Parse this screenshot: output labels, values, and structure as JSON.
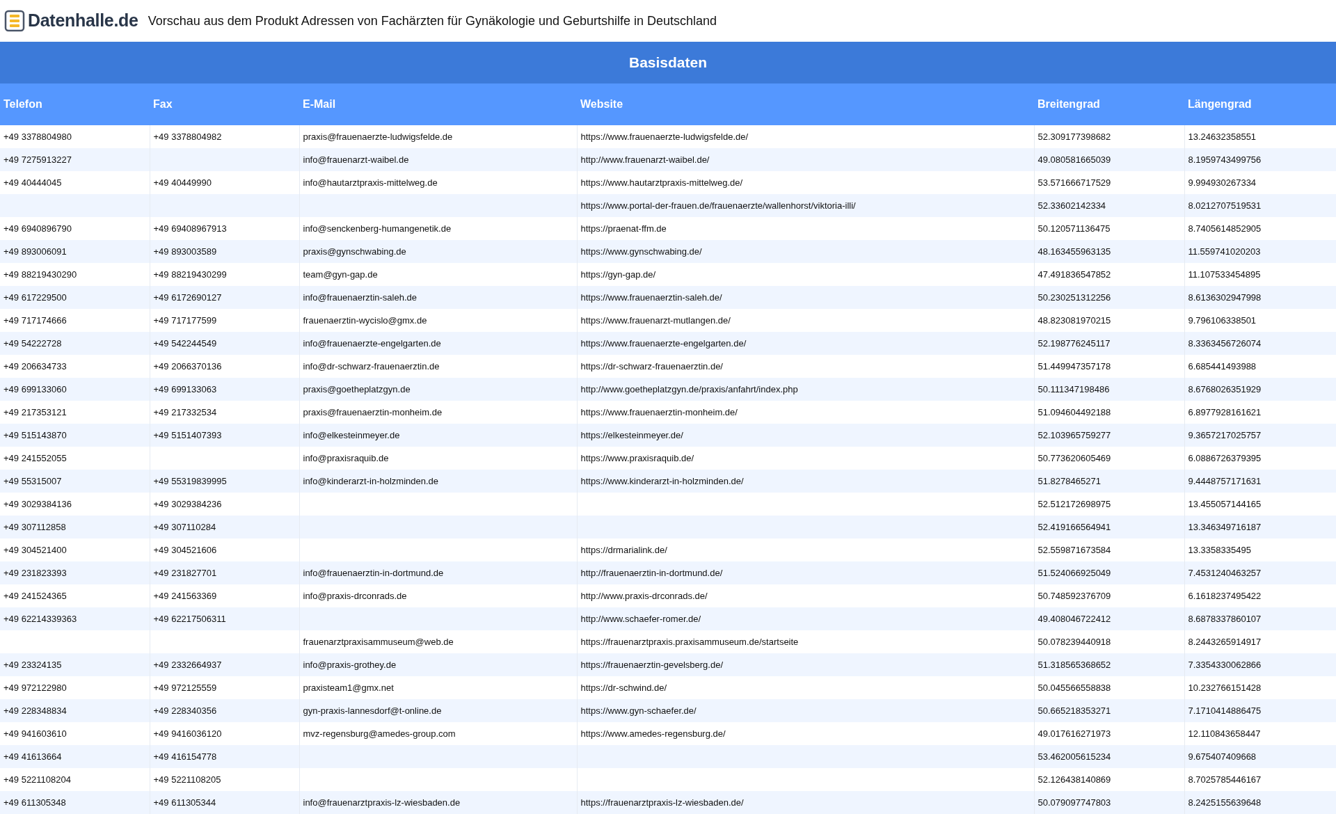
{
  "header": {
    "logo_text": "Datenhalle.de",
    "title": "Vorschau aus dem Produkt Adressen von Fachärzten für Gynäkologie und Geburtshilfe in Deutschland"
  },
  "table": {
    "group_title": "Basisdaten",
    "columns": [
      "Telefon",
      "Fax",
      "E-Mail",
      "Website",
      "Breitengrad",
      "Längengrad"
    ],
    "rows": [
      [
        "+49 3378804980",
        "+49 3378804982",
        "praxis@frauenaerzte-ludwigsfelde.de",
        "https://www.frauenaerzte-ludwigsfelde.de/",
        "52.309177398682",
        "13.24632358551"
      ],
      [
        "+49 7275913227",
        null,
        "info@frauenarzt-waibel.de",
        "http://www.frauenarzt-waibel.de/",
        "49.080581665039",
        "8.1959743499756"
      ],
      [
        "+49 40444045",
        "+49 40449990",
        "info@hautarztpraxis-mittelweg.de",
        "https://www.hautarztpraxis-mittelweg.de/",
        "53.571666717529",
        "9.994930267334"
      ],
      [
        null,
        null,
        null,
        "https://www.portal-der-frauen.de/frauenaerzte/wallenhorst/viktoria-illi/",
        "52.33602142334",
        "8.0212707519531"
      ],
      [
        "+49 6940896790",
        "+49 69408967913",
        "info@senckenberg-humangenetik.de",
        "https://praenat-ffm.de",
        "50.120571136475",
        "8.7405614852905"
      ],
      [
        "+49 893006091",
        "+49 893003589",
        "praxis@gynschwabing.de",
        "https://www.gynschwabing.de/",
        "48.163455963135",
        "11.559741020203"
      ],
      [
        "+49 88219430290",
        "+49 88219430299",
        "team@gyn-gap.de",
        "https://gyn-gap.de/",
        "47.491836547852",
        "11.107533454895"
      ],
      [
        "+49 617229500",
        "+49 6172690127",
        "info@frauenaerztin-saleh.de",
        "https://www.frauenaerztin-saleh.de/",
        "50.230251312256",
        "8.6136302947998"
      ],
      [
        "+49 717174666",
        "+49 717177599",
        "frauenaerztin-wycislo@gmx.de",
        "https://www.frauenarzt-mutlangen.de/",
        "48.823081970215",
        "9.796106338501"
      ],
      [
        "+49 54222728",
        "+49 542244549",
        "info@frauenaerzte-engelgarten.de",
        "https://www.frauenaerzte-engelgarten.de/",
        "52.198776245117",
        "8.3363456726074"
      ],
      [
        "+49 206634733",
        "+49 2066370136",
        "info@dr-schwarz-frauenaerztin.de",
        "https://dr-schwarz-frauenaerztin.de/",
        "51.449947357178",
        "6.685441493988"
      ],
      [
        "+49 699133060",
        "+49 699133063",
        "praxis@goetheplatzgyn.de",
        "http://www.goetheplatzgyn.de/praxis/anfahrt/index.php",
        "50.111347198486",
        "8.6768026351929"
      ],
      [
        "+49 217353121",
        "+49 217332534",
        "praxis@frauenaerztin-monheim.de",
        "https://www.frauenaerztin-monheim.de/",
        "51.094604492188",
        "6.8977928161621"
      ],
      [
        "+49 515143870",
        "+49 5151407393",
        "info@elkesteinmeyer.de",
        "https://elkesteinmeyer.de/",
        "52.103965759277",
        "9.3657217025757"
      ],
      [
        "+49 241552055",
        null,
        "info@praxisraquib.de",
        "https://www.praxisraquib.de/",
        "50.773620605469",
        "6.0886726379395"
      ],
      [
        "+49 55315007",
        "+49 55319839995",
        "info@kinderarzt-in-holzminden.de",
        "https://www.kinderarzt-in-holzminden.de/",
        "51.8278465271",
        "9.4448757171631"
      ],
      [
        "+49 3029384136",
        "+49 3029384236",
        null,
        null,
        "52.512172698975",
        "13.455057144165"
      ],
      [
        "+49 307112858",
        "+49 307110284",
        null,
        null,
        "52.419166564941",
        "13.346349716187"
      ],
      [
        "+49 304521400",
        "+49 304521606",
        null,
        "https://drmarialink.de/",
        "52.559871673584",
        "13.3358335495"
      ],
      [
        "+49 231823393",
        "+49 231827701",
        "info@frauenaerztin-in-dortmund.de",
        "http://frauenaerztin-in-dortmund.de/",
        "51.524066925049",
        "7.4531240463257"
      ],
      [
        "+49 241524365",
        "+49 241563369",
        "info@praxis-drconrads.de",
        "http://www.praxis-drconrads.de/",
        "50.748592376709",
        "6.1618237495422"
      ],
      [
        "+49 62214339363",
        "+49 62217506311",
        null,
        "http://www.schaefer-romer.de/",
        "49.408046722412",
        "8.6878337860107"
      ],
      [
        null,
        null,
        "frauenarztpraxisammuseum@web.de",
        "https://frauenarztpraxis.praxisammuseum.de/startseite",
        "50.078239440918",
        "8.2443265914917"
      ],
      [
        "+49 23324135",
        "+49 2332664937",
        "info@praxis-grothey.de",
        "https://frauenaerztin-gevelsberg.de/",
        "51.318565368652",
        "7.3354330062866"
      ],
      [
        "+49 972122980",
        "+49 972125559",
        "praxisteam1@gmx.net",
        "https://dr-schwind.de/",
        "50.045566558838",
        "10.232766151428"
      ],
      [
        "+49 228348834",
        "+49 228340356",
        "gyn-praxis-lannesdorf@t-online.de",
        "https://www.gyn-schaefer.de/",
        "50.665218353271",
        "7.1710414886475"
      ],
      [
        "+49 941603610",
        "+49 9416036120",
        "mvz-regensburg@amedes-group.com",
        "https://www.amedes-regensburg.de/",
        "49.017616271973",
        "12.110843658447"
      ],
      [
        "+49 41613664",
        "+49 416154778",
        null,
        null,
        "53.462005615234",
        "9.675407409668"
      ],
      [
        "+49 5221108204",
        "+49 5221108205",
        null,
        null,
        "52.126438140869",
        "8.7025785446167"
      ],
      [
        "+49 611305348",
        "+49 611305344",
        "info@frauenarztpraxis-lz-wiesbaden.de",
        "https://frauenarztpraxis-lz-wiesbaden.de/",
        "50.079097747803",
        "8.2425155639648"
      ]
    ]
  }
}
